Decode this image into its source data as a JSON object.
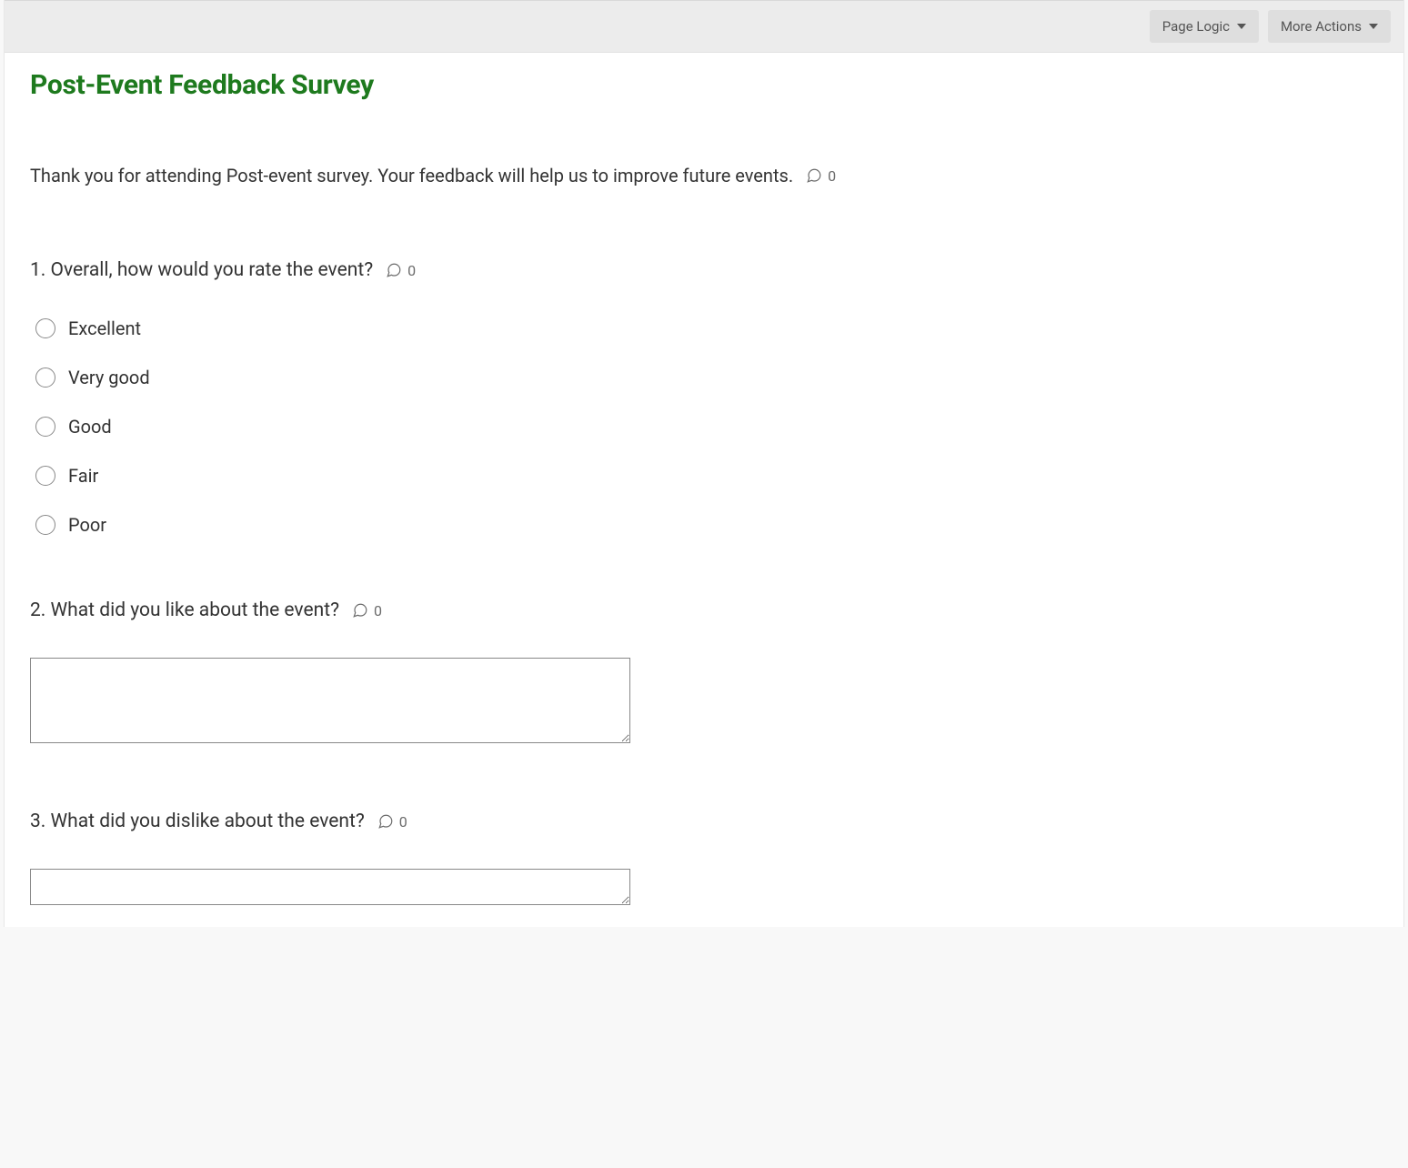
{
  "toolbar": {
    "page_logic_label": "Page Logic",
    "more_actions_label": "More Actions"
  },
  "survey": {
    "title": "Post-Event Feedback Survey",
    "intro_text": "Thank you for attending Post-event survey. Your feedback will help us to improve future events.",
    "intro_comment_count": "0"
  },
  "questions": {
    "q1": {
      "text": "1. Overall, how would you rate the event?",
      "comment_count": "0",
      "options": {
        "o0": "Excellent",
        "o1": "Very good",
        "o2": "Good",
        "o3": "Fair",
        "o4": "Poor"
      }
    },
    "q2": {
      "text": "2. What did you like about the event?",
      "comment_count": "0",
      "value": ""
    },
    "q3": {
      "text": "3. What did you dislike about the event?",
      "comment_count": "0",
      "value": ""
    }
  }
}
